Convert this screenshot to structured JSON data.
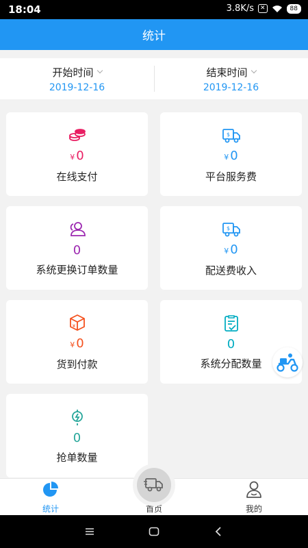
{
  "status_bar": {
    "time": "18:04",
    "speed": "3.8K/s",
    "battery": "88"
  },
  "header": {
    "title": "统计"
  },
  "date_range": {
    "start_label": "开始时间",
    "start_value": "2019-12-16",
    "end_label": "结束时间",
    "end_value": "2019-12-16"
  },
  "currency_symbol": "¥",
  "cards": [
    {
      "label": "在线支付",
      "value": "0",
      "color": "#E91E63",
      "icon": "coins-icon"
    },
    {
      "label": "平台服务费",
      "value": "0",
      "color": "#2196F3",
      "icon": "delivery-truck-icon"
    },
    {
      "label": "系统更换订单数量",
      "value": "0",
      "color": "#9C27B0",
      "icon": "users-icon"
    },
    {
      "label": "配送费收入",
      "value": "0",
      "color": "#2196F3",
      "icon": "delivery-truck-icon"
    },
    {
      "label": "货到付款",
      "value": "0",
      "color": "#F4511E",
      "icon": "package-icon"
    },
    {
      "label": "系统分配数量",
      "value": "0",
      "color": "#00ACC1",
      "icon": "clipboard-check-icon"
    },
    {
      "label": "抢单数量",
      "value": "0",
      "color": "#26A69A",
      "icon": "grab-order-icon"
    }
  ],
  "tabs": [
    {
      "label": "统计",
      "icon": "pie-chart-icon",
      "active": true
    },
    {
      "label": "首页",
      "icon": "truck-icon",
      "active": false
    },
    {
      "label": "我的",
      "icon": "user-icon",
      "active": false
    }
  ]
}
